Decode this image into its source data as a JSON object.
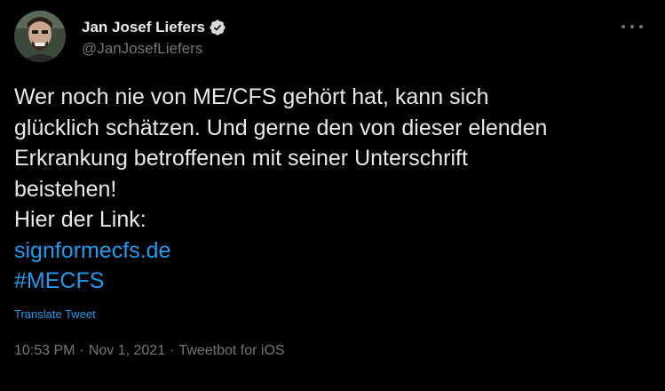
{
  "author": {
    "display_name": "Jan Josef Liefers",
    "handle": "@JanJosefLiefers",
    "verified_icon": "verified-badge-icon",
    "avatar_icon": "avatar-photo"
  },
  "menu": {
    "more_icon": "more-options-icon"
  },
  "tweet": {
    "lines": [
      "Wer noch nie von ME/CFS gehört hat, kann sich",
      "glücklich schätzen. Und gerne den von dieser elenden",
      "Erkrankung betroffenen mit seiner Unterschrift",
      "beistehen!",
      "Hier der Link:"
    ],
    "link_text": "signformecfs.de",
    "hashtag": "#MECFS",
    "translate_label": "Translate Tweet"
  },
  "meta": {
    "time": "10:53 PM",
    "separator": "·",
    "date": "Nov 1, 2021",
    "client": "Tweetbot for iOS"
  },
  "colors": {
    "background": "#000000",
    "text": "#e7e9ea",
    "secondary": "#71767b",
    "link": "#1d9bf0",
    "verified": "#d9d9d9"
  }
}
